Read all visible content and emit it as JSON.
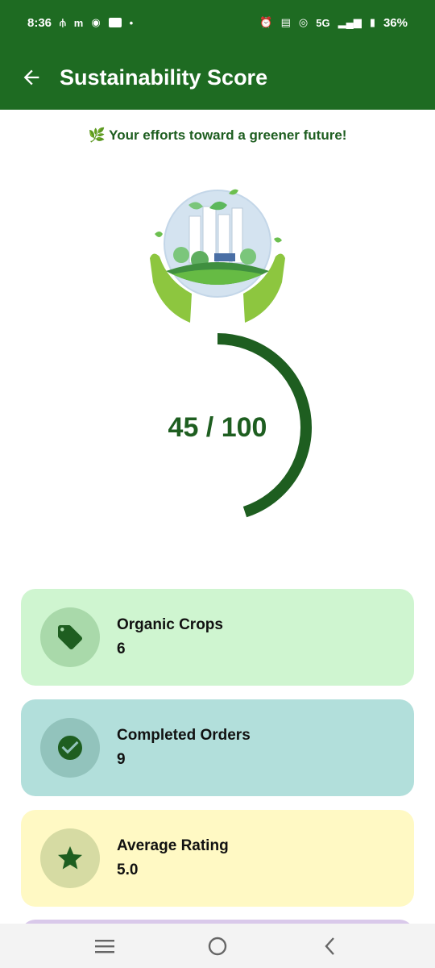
{
  "status_bar": {
    "time": "8:36",
    "battery": "36%",
    "network": "5G"
  },
  "app_bar": {
    "title": "Sustainability Score"
  },
  "subtitle": "🌿 Your efforts toward a greener future!",
  "score": {
    "text": "45 / 100",
    "value": 45,
    "max": 100
  },
  "colors": {
    "primary": "#1e6b22",
    "gauge": "#1e5e20"
  },
  "cards": [
    {
      "label": "Organic Crops",
      "value": "6",
      "icon": "tag-icon",
      "bg": "#cff5d0",
      "icon_bg": "#a9d9aa"
    },
    {
      "label": "Completed Orders",
      "value": "9",
      "icon": "check-circle-icon",
      "bg": "#b2dfdb",
      "icon_bg": "#92c3bc"
    },
    {
      "label": "Average Rating",
      "value": "5.0",
      "icon": "star-icon",
      "bg": "#fff9c4",
      "icon_bg": "#d6dba3"
    }
  ]
}
